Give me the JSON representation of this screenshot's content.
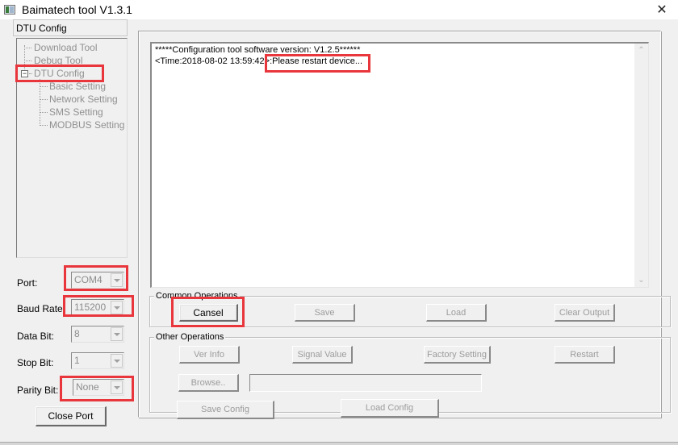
{
  "window": {
    "title": "Baimatech tool V1.3.1",
    "icon": "app-window-icon",
    "close_glyph": "✕"
  },
  "left_panel": {
    "tab_label": "DTU Config",
    "tree": [
      {
        "label": "Download Tool",
        "level": 0,
        "selected": false
      },
      {
        "label": "Debug Tool",
        "level": 0,
        "selected": false
      },
      {
        "label": "DTU Config",
        "level": 0,
        "expanded": true,
        "expander_glyph": "−",
        "highlighted": true
      },
      {
        "label": "Basic Setting",
        "level": 1
      },
      {
        "label": "Network Setting",
        "level": 1
      },
      {
        "label": "SMS Setting",
        "level": 1
      },
      {
        "label": "MODBUS Setting",
        "level": 1
      }
    ],
    "serial": {
      "port": {
        "label": "Port:",
        "value": "COM4",
        "highlighted": true
      },
      "baud_rate": {
        "label": "Baud Rate",
        "value": "115200",
        "highlighted": true
      },
      "data_bit": {
        "label": "Data Bit:",
        "value": "8"
      },
      "stop_bit": {
        "label": "Stop Bit:",
        "value": "1"
      },
      "parity_bit": {
        "label": "Parity Bit:",
        "value": "None",
        "highlighted": true
      }
    },
    "close_port_label": "Close Port"
  },
  "output": {
    "lines": [
      "*****Configuration tool software version: V1.2.5******",
      "<Time:2018-08-02 13:59:42>:Please restart device..."
    ],
    "highlighted_text": ":Please restart device...",
    "scroll_up": "⌃",
    "scroll_down": "⌄"
  },
  "common_operations": {
    "title": "Common Operations",
    "buttons": {
      "cancel": "Cansel",
      "save": "Save",
      "load": "Load",
      "clear_output": "Clear Output"
    }
  },
  "other_operations": {
    "title": "Other Operations",
    "buttons": {
      "ver_info": "Ver Info",
      "signal_value": "Signal Value",
      "factory_setting": "Factory Setting",
      "restart": "Restart",
      "browse": "Browse..",
      "save_config": "Save Config",
      "load_config": "Load Config"
    },
    "path_value": ""
  },
  "colors": {
    "highlight_box": "#e8363c",
    "window_bg": "#f0f0f0",
    "disabled_text": "#9c9c9c"
  }
}
